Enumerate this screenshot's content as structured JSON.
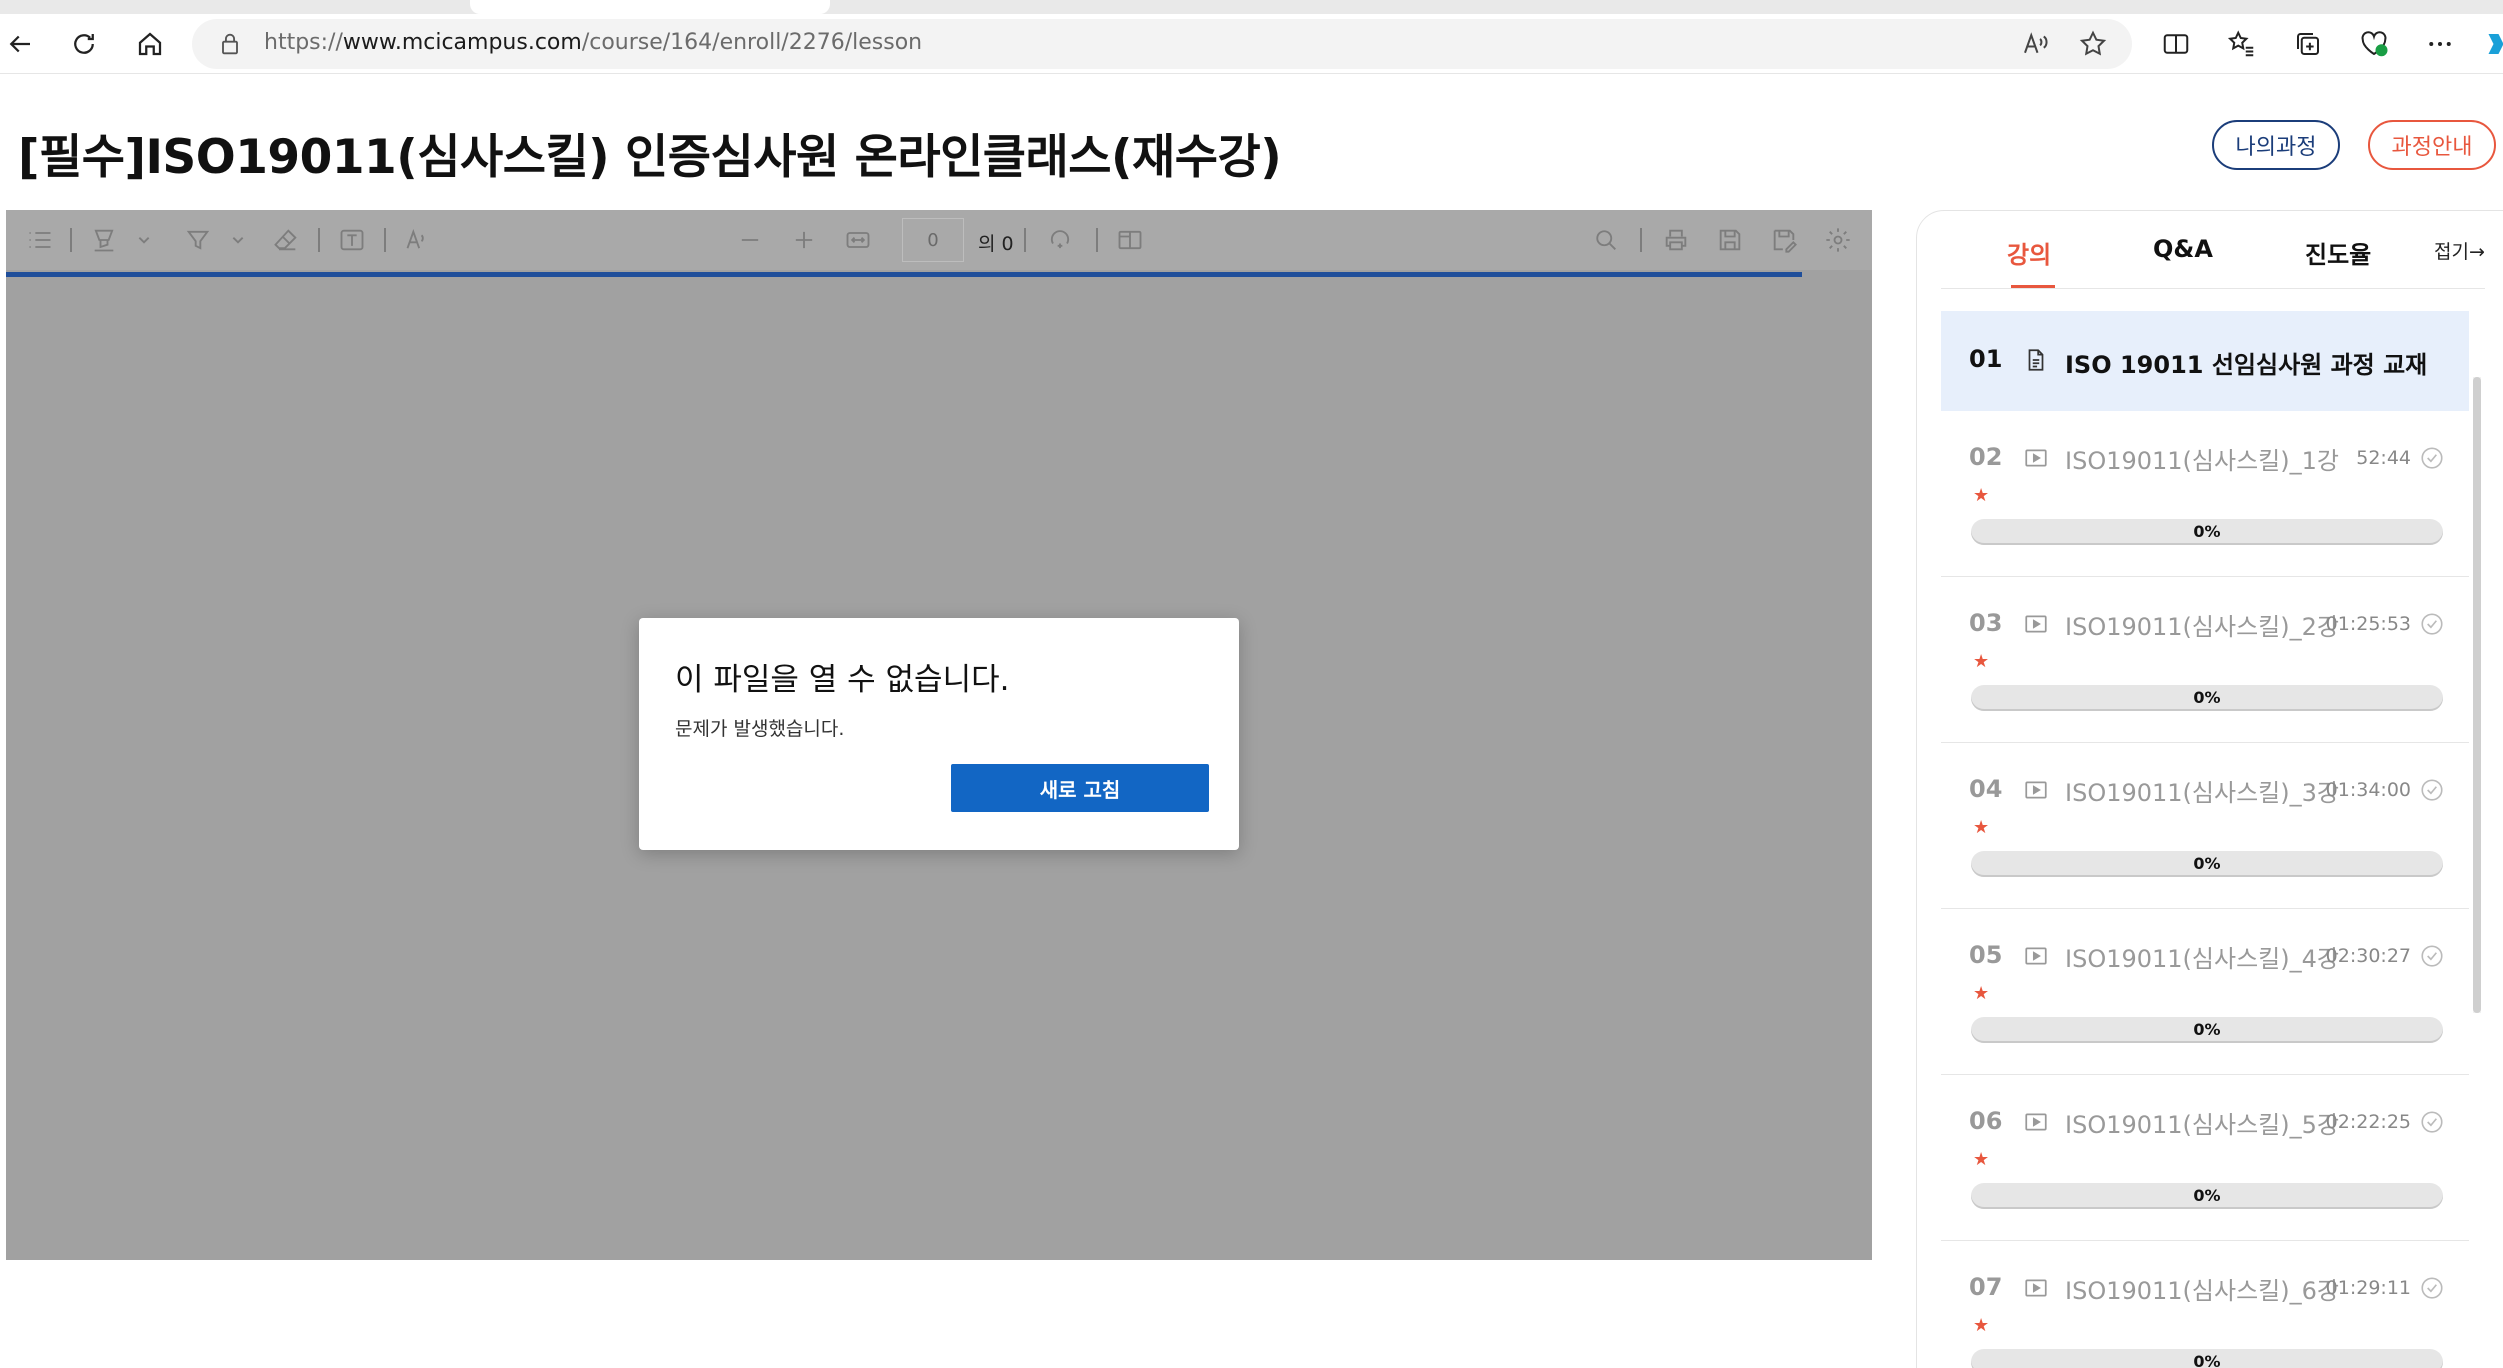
{
  "browser": {
    "url_prefix": "https://",
    "url_host": "www.mcicampus.com",
    "url_path": "/course/164/enroll/2276/lesson"
  },
  "page": {
    "title": "[필수]ISO19011(심사스킬) 인증심사원 온라인클래스(재수강)",
    "my_course_label": "나의과정",
    "course_info_label": "과정안내"
  },
  "viewer": {
    "page_number": "0",
    "page_total_label": "의 0",
    "dialog": {
      "title": "이 파일을 열 수 없습니다.",
      "message": "문제가 발생했습니다.",
      "button": "새로 고침"
    }
  },
  "panel": {
    "tabs": [
      "강의",
      "Q&A",
      "진도율"
    ],
    "active_tab": "강의",
    "fold_label": "접기→",
    "accent_color": "#e8573e",
    "lessons": [
      {
        "num": "01",
        "type": "document",
        "title": "ISO 19011 선임심사원 과정 교재",
        "time": "",
        "progress": ""
      },
      {
        "num": "02",
        "type": "video",
        "title": "ISO19011(심사스킬)_1강",
        "time": "52:44",
        "progress": "0%"
      },
      {
        "num": "03",
        "type": "video",
        "title": "ISO19011(심사스킬)_2강",
        "time": "01:25:53",
        "progress": "0%"
      },
      {
        "num": "04",
        "type": "video",
        "title": "ISO19011(심사스킬)_3강",
        "time": "01:34:00",
        "progress": "0%"
      },
      {
        "num": "05",
        "type": "video",
        "title": "ISO19011(심사스킬)_4강",
        "time": "02:30:27",
        "progress": "0%"
      },
      {
        "num": "06",
        "type": "video",
        "title": "ISO19011(심사스킬)_5강",
        "time": "02:22:25",
        "progress": "0%"
      },
      {
        "num": "07",
        "type": "video",
        "title": "ISO19011(심사스킬)_6강",
        "time": "01:29:11",
        "progress": "0%"
      }
    ]
  }
}
